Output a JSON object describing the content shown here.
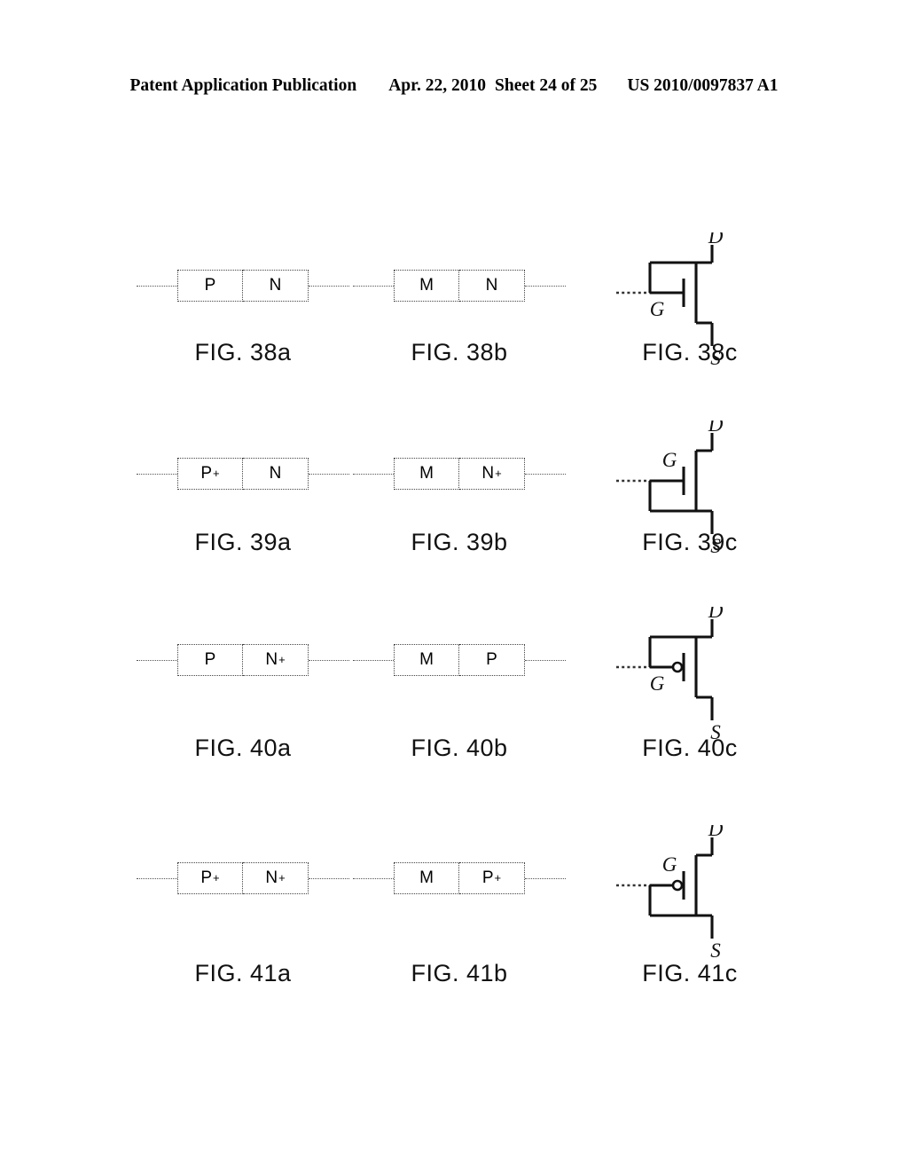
{
  "header": {
    "publication": "Patent Application Publication",
    "date": "Apr. 22, 2010",
    "sheet": "Sheet 24 of 25",
    "docnumber": "US 2010/0097837 A1"
  },
  "symbol_labels": {
    "drain": "D",
    "gate": "G",
    "source": "S"
  },
  "figures": [
    {
      "id": "fig-38a",
      "caption": "FIG. 38a",
      "type": "block",
      "cells": [
        {
          "base": "P",
          "sup": ""
        },
        {
          "base": "N",
          "sup": ""
        }
      ]
    },
    {
      "id": "fig-38b",
      "caption": "FIG. 38b",
      "type": "block",
      "cells": [
        {
          "base": "M",
          "sup": ""
        },
        {
          "base": "N",
          "sup": ""
        }
      ]
    },
    {
      "id": "fig-38c",
      "caption": "FIG. 38c",
      "type": "symbol",
      "bubble": false,
      "loop": "up",
      "gate_label_position": "below"
    },
    {
      "id": "fig-39a",
      "caption": "FIG. 39a",
      "type": "block",
      "cells": [
        {
          "base": "P",
          "sup": "+"
        },
        {
          "base": "N",
          "sup": ""
        }
      ]
    },
    {
      "id": "fig-39b",
      "caption": "FIG. 39b",
      "type": "block",
      "cells": [
        {
          "base": "M",
          "sup": ""
        },
        {
          "base": "N",
          "sup": "+"
        }
      ]
    },
    {
      "id": "fig-39c",
      "caption": "FIG. 39c",
      "type": "symbol",
      "bubble": false,
      "loop": "down",
      "gate_label_position": "above"
    },
    {
      "id": "fig-40a",
      "caption": "FIG. 40a",
      "type": "block",
      "cells": [
        {
          "base": "P",
          "sup": ""
        },
        {
          "base": "N",
          "sup": "+"
        }
      ]
    },
    {
      "id": "fig-40b",
      "caption": "FIG. 40b",
      "type": "block",
      "cells": [
        {
          "base": "M",
          "sup": ""
        },
        {
          "base": "P",
          "sup": ""
        }
      ]
    },
    {
      "id": "fig-40c",
      "caption": "FIG. 40c",
      "type": "symbol",
      "bubble": true,
      "loop": "up",
      "gate_label_position": "below"
    },
    {
      "id": "fig-41a",
      "caption": "FIG. 41a",
      "type": "block",
      "cells": [
        {
          "base": "P",
          "sup": "+"
        },
        {
          "base": "N",
          "sup": "+"
        }
      ]
    },
    {
      "id": "fig-41b",
      "caption": "FIG. 41b",
      "type": "block",
      "cells": [
        {
          "base": "M",
          "sup": ""
        },
        {
          "base": "P",
          "sup": "+"
        }
      ]
    },
    {
      "id": "fig-41c",
      "caption": "FIG. 41c",
      "type": "symbol",
      "bubble": true,
      "loop": "down",
      "gate_label_position": "above"
    }
  ]
}
